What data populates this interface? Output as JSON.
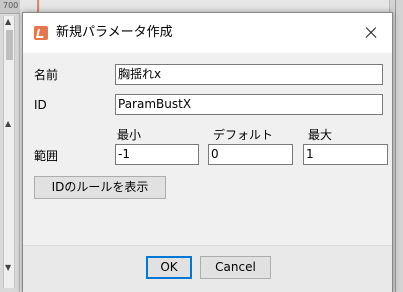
{
  "background": {
    "ruler_label": "700"
  },
  "dialog": {
    "title": "新規パラメータ作成",
    "fields": {
      "name_label": "名前",
      "name_value": "胸揺れx",
      "id_label": "ID",
      "id_value": "ParamBustX",
      "range_label": "範囲",
      "min_label": "最小",
      "default_label": "デフォルト",
      "max_label": "最大",
      "min_value": "-1",
      "default_value": "0",
      "max_value": "1"
    },
    "show_id_rules_label": "IDのルールを表示",
    "ok_label": "OK",
    "cancel_label": "Cancel"
  },
  "colors": {
    "accent": "#0078d7",
    "app_icon": "#e8764a"
  }
}
